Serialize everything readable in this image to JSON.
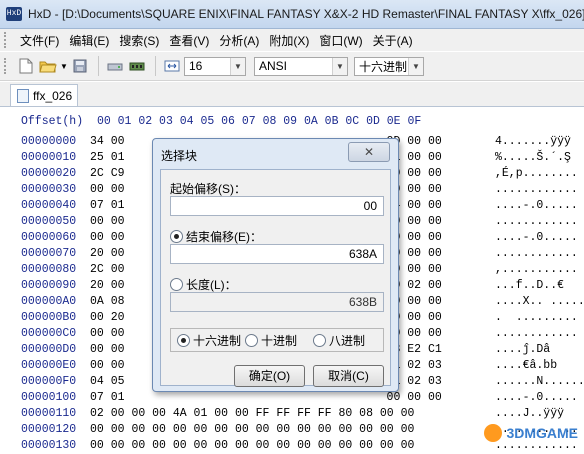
{
  "window": {
    "app_icon": "HxD",
    "title": "HxD - [D:\\Documents\\SQUARE ENIX\\FINAL FANTASY X&X-2 HD Remaster\\FINAL FANTASY X\\ffx_026]"
  },
  "menu": [
    "文件(F)",
    "编辑(E)",
    "搜索(S)",
    "查看(V)",
    "分析(A)",
    "附加(X)",
    "窗口(W)",
    "关于(A)"
  ],
  "toolbar": {
    "bytes_per_row": "16",
    "charset": "ANSI",
    "offset_base": "十六进制",
    "icons": [
      "new-file-icon",
      "open-folder-icon",
      "save-icon",
      "disk-icon",
      "ram-icon",
      "columns-icon"
    ]
  },
  "tab": {
    "label": "ffx_026"
  },
  "editor": {
    "header_offset": "Offset(h)",
    "header_cols": "00 01 02 03 04 05 06 07 08 09 0A 0B 0C 0D 0E 0F",
    "rows": [
      {
        "off": "00000000",
        "left": "34 00",
        "right": "0D 00 00",
        "txt": "4.......ÿÿÿ"
      },
      {
        "off": "00000010",
        "left": "25 01",
        "right": "01 00 00",
        "txt": "%.....Š.´.Ş"
      },
      {
        "off": "00000020",
        "left": "2C C9",
        "right": "00 00 00",
        "txt": ",É,p........"
      },
      {
        "off": "00000030",
        "left": "00 00",
        "right": "00 00 00",
        "txt": "............"
      },
      {
        "off": "00000040",
        "left": "07 01",
        "right": "B4 00 00",
        "txt": "....-.0....."
      },
      {
        "off": "00000050",
        "left": "00 00",
        "right": "00 00 00",
        "txt": "............"
      },
      {
        "off": "00000060",
        "left": "00 00",
        "right": "00 00 00",
        "txt": "....-.0....."
      },
      {
        "off": "00000070",
        "left": "20 00",
        "right": "00 00 00",
        "txt": "............"
      },
      {
        "off": "00000080",
        "left": "2C 00",
        "right": "00 00 00",
        "txt": ",..........."
      },
      {
        "off": "00000090",
        "left": "20 00",
        "right": "20 02 00",
        "txt": "...f..D..€"
      },
      {
        "off": "000000A0",
        "left": "0A 08",
        "right": "00 00 00",
        "txt": "....X.. ....."
      },
      {
        "off": "000000B0",
        "left": "00 20",
        "right": "00 00 00",
        "txt": ".  ........."
      },
      {
        "off": "000000C0",
        "left": "00 00",
        "right": "00 00 00",
        "txt": "............"
      },
      {
        "off": "000000D0",
        "left": "00 00",
        "right": "43 E2 C1",
        "txt": "....ĵ.Dâ"
      },
      {
        "off": "000000E0",
        "left": "00 00",
        "right": "01 02 03",
        "txt": "....€â.bb"
      },
      {
        "off": "000000F0",
        "left": "04 05",
        "right": "01 02 03",
        "txt": "......N......"
      },
      {
        "off": "00000100",
        "left": "07 01",
        "right": "00 00 00",
        "txt": "....-.0....."
      },
      {
        "off": "00000110",
        "left": "02 00 00 00 4A 01 00 00 FF FF FF FF 80 08 00 00",
        "right": "",
        "txt": "....J..ÿÿÿ"
      },
      {
        "off": "00000120",
        "left": "00 00 00 00 00 00 00 00 00 00 00 00 00 00 00 00",
        "right": "",
        "txt": "............"
      },
      {
        "off": "00000130",
        "left": "00 00 00 00 00 00 00 00 00 00 00 00 00 00 00 00",
        "right": "",
        "txt": "............"
      }
    ]
  },
  "dialog": {
    "title": "选择块",
    "close_glyph": "✕",
    "start_label": "起始偏移(S)：",
    "start_value": "00",
    "end_label": "结束偏移(E)：",
    "end_value": "638A",
    "length_label": "长度(L)：",
    "length_value": "638B",
    "base_hex": "十六进制",
    "base_dec": "十进制",
    "base_oct": "八进制",
    "ok": "确定(O)",
    "cancel": "取消(C)"
  },
  "watermark": {
    "text": "3DMGAME"
  }
}
